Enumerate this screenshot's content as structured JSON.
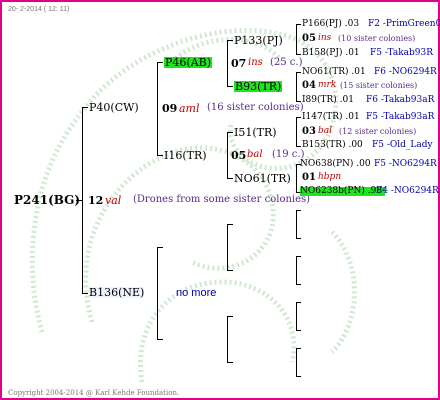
{
  "header": {
    "date": "20-  2-2014 ( 12: 11)"
  },
  "root": {
    "id": "P241(BG)",
    "year": "12",
    "breeder": "val",
    "note": "(Drones from some sister colonies)"
  },
  "gen1": {
    "sire": "P40(CW)",
    "sire_year": "09",
    "sire_breeder": "aml",
    "sire_note": "(16 sister colonies)",
    "dam": "B136(NE)",
    "dam_more": "no more"
  },
  "gen2": {
    "a": "P46(AB)",
    "b": "I16(TR)"
  },
  "gen3": {
    "a": "P133(PJ)",
    "a_year": "07",
    "a_breeder": "ins",
    "a_note": "(25 c.)",
    "b": "B93(TR)",
    "c": "I51(TR)",
    "c_year": "05",
    "c_breeder": "bal",
    "c_note": "(19 c.)",
    "d": "NO61(TR)"
  },
  "gen4": [
    {
      "id": "P166(PJ) .03",
      "extra": "F2 -PrimGreen00",
      "year": "05",
      "breeder": "ins",
      "note": "(10 sister colonies)"
    },
    {
      "id": "B158(PJ) .01",
      "extra": "F5 -Takab93R"
    },
    {
      "id": "NO61(TR) .01",
      "extra": "F6 -NO6294R",
      "year": "04",
      "breeder": "mrk",
      "note": "(15 sister colonies)"
    },
    {
      "id": "I89(TR) .01",
      "extra": "F6 -Takab93aR"
    },
    {
      "id": "I147(TR) .01",
      "extra": "F5 -Takab93aR",
      "year": "03",
      "breeder": "bal",
      "note": "(12 sister colonies)"
    },
    {
      "id": "B153(TR) .00",
      "extra": "F5 -Old_Lady"
    },
    {
      "id": "NO638(PN) .00",
      "extra": "F5 -NO6294R",
      "year": "01",
      "breeder": "hbpn"
    },
    {
      "id": "NO6238b(PN) .98",
      "extra": "F4 -NO6294R"
    }
  ],
  "footer": {
    "copyright": "Copyright 2004-2014 @ Karl Kehde Foundation."
  }
}
